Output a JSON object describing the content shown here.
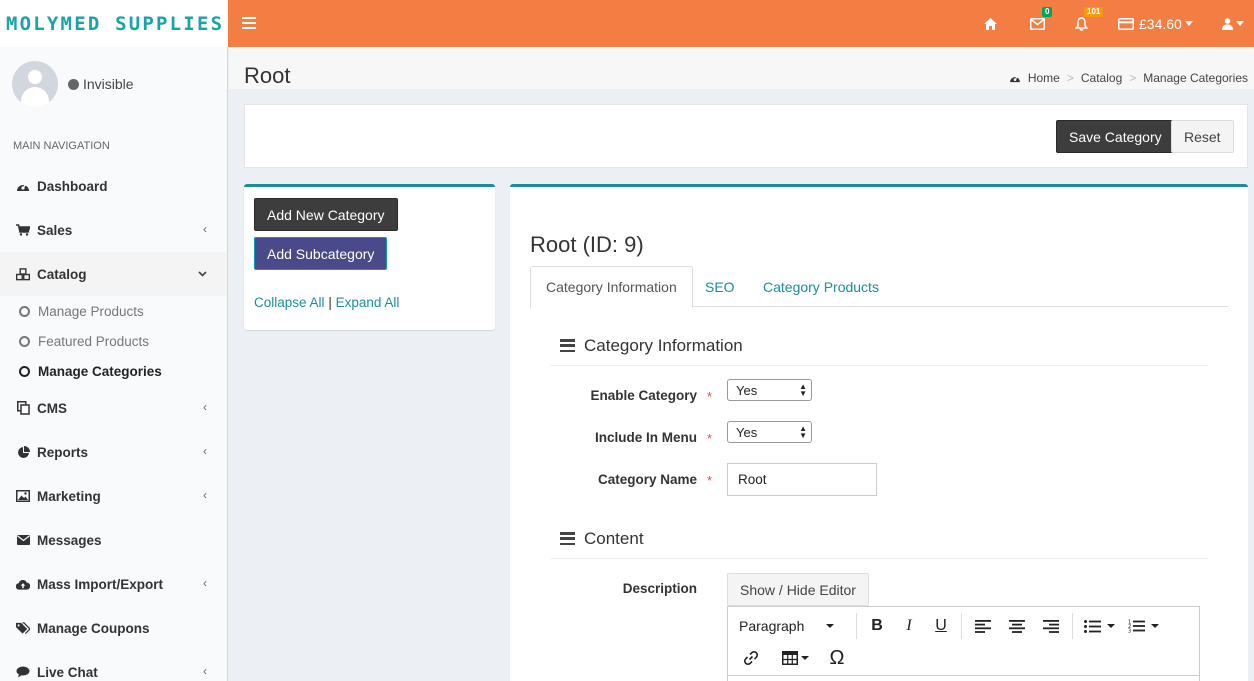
{
  "brand": {
    "logo_text": "MOLYMED SUPPLIES"
  },
  "topbar": {
    "messages_badge": "0",
    "notifications_badge": "101",
    "balance": "£34.60"
  },
  "user": {
    "status": "Invisible"
  },
  "sidebar": {
    "header": "MAIN NAVIGATION",
    "items": [
      {
        "label": "Dashboard"
      },
      {
        "label": "Sales"
      },
      {
        "label": "Catalog"
      },
      {
        "label": "CMS"
      },
      {
        "label": "Reports"
      },
      {
        "label": "Marketing"
      },
      {
        "label": "Messages"
      },
      {
        "label": "Mass Import/Export"
      },
      {
        "label": "Manage Coupons"
      },
      {
        "label": "Live Chat"
      }
    ],
    "catalog_sub": [
      {
        "label": "Manage Products"
      },
      {
        "label": "Featured Products"
      },
      {
        "label": "Manage Categories"
      }
    ]
  },
  "page": {
    "title": "Root"
  },
  "breadcrumb": {
    "home": "Home",
    "catalog": "Catalog",
    "current": "Manage Categories"
  },
  "actions": {
    "save": "Save Category",
    "reset": "Reset"
  },
  "tree": {
    "add_new": "Add New Category",
    "add_sub": "Add Subcategory",
    "collapse": "Collapse All",
    "separator": "|",
    "expand": "Expand All"
  },
  "category": {
    "title": "Root (ID: 9)",
    "tabs": [
      "Category Information",
      "SEO",
      "Category Products"
    ],
    "section_info": "Category Information",
    "enable_label": "Enable Category",
    "enable_value": "Yes",
    "menu_label": "Include In Menu",
    "menu_value": "Yes",
    "name_label": "Category Name",
    "name_value": "Root",
    "required_mark": "*",
    "section_content": "Content",
    "description_label": "Description",
    "toggle_editor": "Show / Hide Editor",
    "format_select": "Paragraph"
  },
  "colors": {
    "topbar": "#f47d43",
    "accent": "#1a8f95",
    "logo": "#1aa3a8"
  }
}
